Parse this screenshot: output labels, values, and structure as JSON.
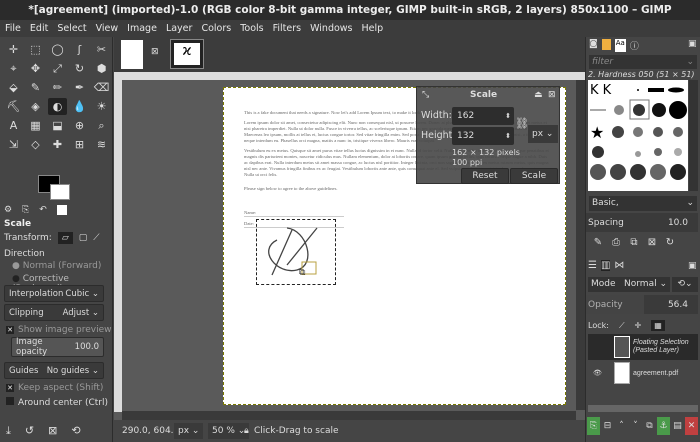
{
  "window": {
    "title": "*[agreement] (imported)-1.0 (RGB color 8-bit gamma integer, GIMP built-in sRGB, 2 layers) 850x1100 – GIMP"
  },
  "menu": [
    "File",
    "Edit",
    "Select",
    "View",
    "Image",
    "Layer",
    "Colors",
    "Tools",
    "Filters",
    "Windows",
    "Help"
  ],
  "tools": [
    "✛",
    "⬚",
    "◯",
    "ʃ",
    "✂",
    "⌖",
    "✥",
    "⤢",
    "↻",
    "⬢",
    "⬙",
    "✎",
    "✏",
    "✒",
    "⌫",
    "⛏",
    "◈",
    "◐",
    "💧",
    "☀",
    "A",
    "▦",
    "⬓",
    "⊕",
    "⌕",
    "⇲",
    "◇",
    "✚",
    "⊞",
    "≋"
  ],
  "tool_options": {
    "title": "Scale",
    "transform_label": "Transform:",
    "direction_label": "Direction",
    "direction_normal": "Normal (Forward)",
    "direction_corrective": "Corrective (Backward)",
    "interpolation_label": "Interpolation",
    "interpolation_value": "Cubic",
    "clipping_label": "Clipping",
    "clipping_value": "Adjust",
    "show_preview": "Show image preview",
    "opacity_label": "Image opacity",
    "opacity_value": "100.0",
    "guides_label": "Guides",
    "guides_value": "No guides",
    "keep_aspect": "Keep aspect (Shift)",
    "around_center": "Around center (Ctrl)"
  },
  "scale_dialog": {
    "title": "Scale",
    "width_label": "Width:",
    "width_value": "162",
    "height_label": "Height:",
    "height_value": "132",
    "unit": "px",
    "size_info": "162 × 132 pixels",
    "resolution": "100 ppi",
    "reset": "Reset",
    "scale": "Scale"
  },
  "document": {
    "p1": "This is a fake document that needs a signature. Now let's add Lorem Ipsum text, to make it look more normal-ish.",
    "p2": "Lorem ipsum dolor sit amet, consectetur adipiscing elit. Nunc non consequat nisl, ut posuere lorem. Donec at pharetra metus, a varius elit. Praesent sit amet metus et nisi pharetra imperdiet. Nulla ut dolor nulla. Fusce in viverra tellus, ac scelerisque ipsum. Etiam nec gravida metus. Nullam id augue pharetra maximus id nec purus. Maecenas leo ipsum, mollis at tellus et, luctus congue tortor. Sed vitae fringilla enim. Sed porta quis sem eget hendrerit. Etiam pellentesque neque nisi, a tincidunt neque interdum eu. Phasellus orci magna, mattis a nunc in, tristique viverra libero. Mauris erat volutpat.",
    "p3": "Vestibulum eu ex metus. Quisque sit amet purus vitae tellus luctus dignissim in et nunc. Nulla id tortor velit. Nulla non hendrerit leo. Orci varius natoque penatibus et magnis dis parturient montes, nascetur ridiculus mus. Nullam elementum, dolor at lobortis ornare, quam ipsum gravida tellus, quis facilisis neque augue a nibh. Duis ac dapibus erat. Nulla interdum metus sit amet massa congue, ac luctus nisl porttitor. Integer lacinia, orci non sagittis sollicitudin, ex metus rutrum metus, quis magna nisl nec ante. Vivamus fringilla finibus ex ac feugiat. Vestibulum lobortis ante ante, quis consequat ante el. Sed vulputate felis enim, ut interdum nunc elementum ac. Nulla ut orci felis.",
    "sign_line": "Please sign below to agree to the above guidelines.",
    "name_label": "Name:",
    "date_label": "Date:"
  },
  "status": {
    "coords": "290.0, 604.0",
    "unit": "px",
    "zoom": "50 %",
    "message": "Click-Drag to scale"
  },
  "brushes": {
    "filter_placeholder": "filter",
    "current": "2. Hardness 050 (51 × 51)",
    "preset": "Basic,",
    "spacing_label": "Spacing",
    "spacing_value": "10.0"
  },
  "layers": {
    "mode_label": "Mode",
    "mode_value": "Normal",
    "opacity_label": "Opacity",
    "opacity_value": "56.4",
    "lock_label": "Lock:",
    "items": [
      {
        "name": "Floating Selection (Pasted Layer)",
        "line1": "Floating Select",
        "line2": "(Pasted Layer)"
      },
      {
        "name": "agreement.pdf",
        "line1": "agreement.pdf"
      }
    ]
  },
  "colors": {
    "accent_green": "#4a9a4a",
    "delete_red": "#c04040",
    "selection": "#b8a040"
  }
}
